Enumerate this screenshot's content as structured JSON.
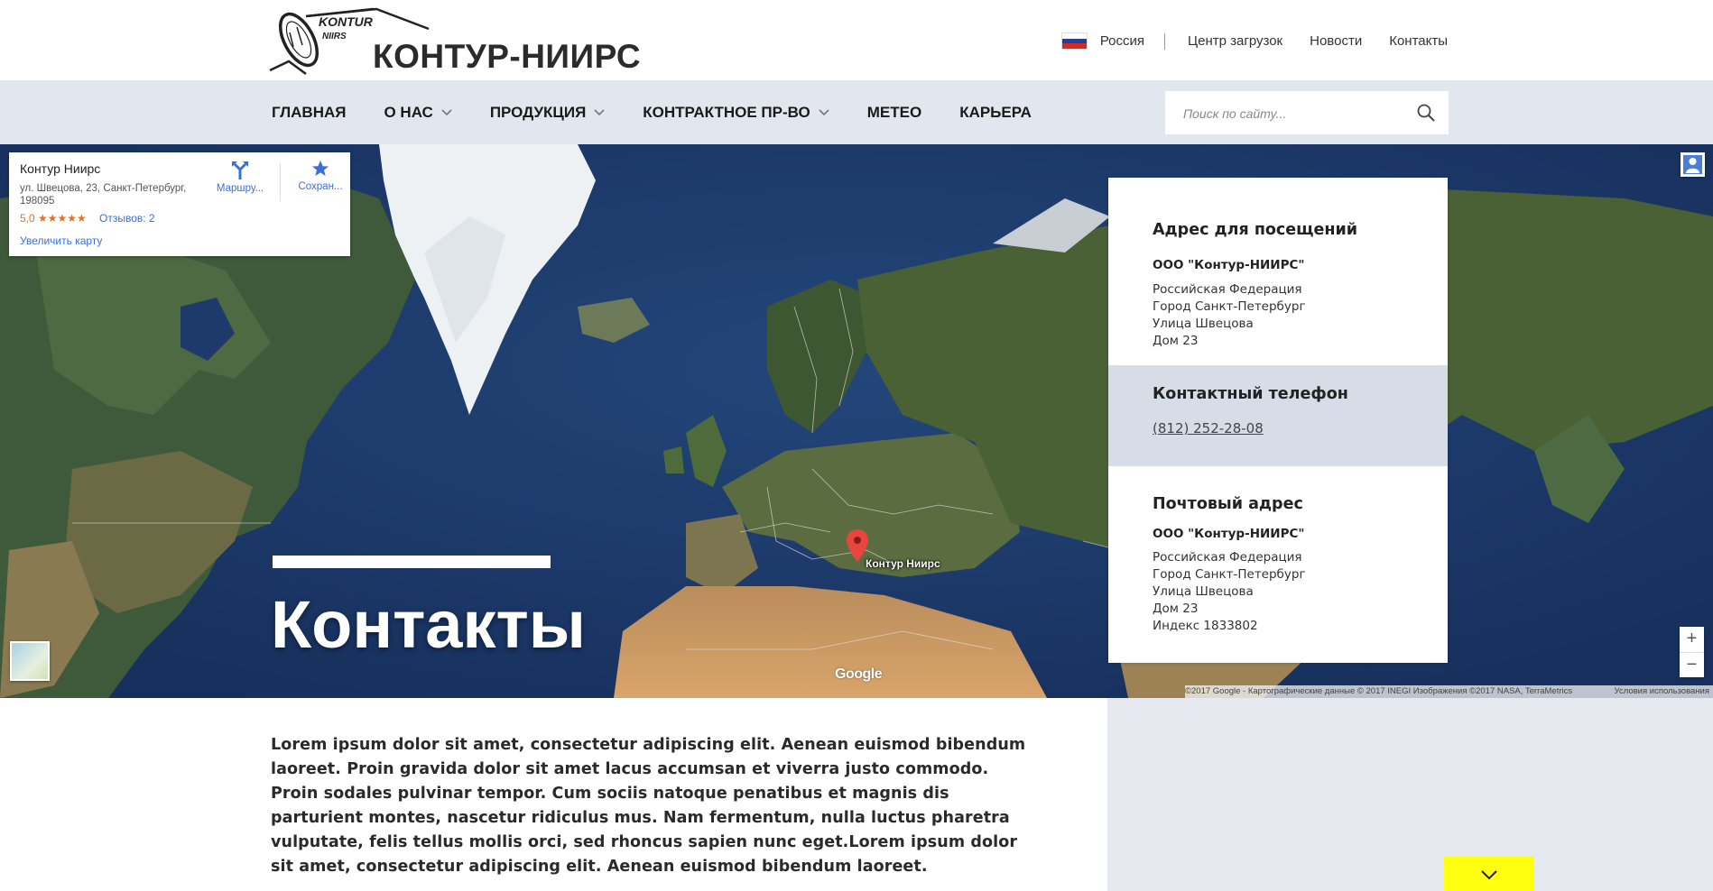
{
  "header": {
    "logo_small_top": "KONTUR",
    "logo_small_bottom": "NIIRS",
    "logo_text": "КОНТУР-НИИРС",
    "region": "Россия",
    "links": [
      "Центр загрузок",
      "Новости",
      "Контакты"
    ]
  },
  "nav": {
    "items": [
      {
        "label": "ГЛАВНАЯ"
      },
      {
        "label": "О НАС"
      },
      {
        "label": "ПРОДУКЦИЯ"
      },
      {
        "label": "КОНТРАКТНОЕ ПР-ВО"
      },
      {
        "label": "МЕТЕО"
      },
      {
        "label": "КАРЬЕРА"
      }
    ],
    "search_placeholder": "Поиск по сайту..."
  },
  "map": {
    "place_name": "Контур Ниирс",
    "place_address": "ул. Швецова, 23, Санкт-Петербург, 198095",
    "rating": "5,0 ★★★★★",
    "reviews": "Отзывов: 2",
    "route_label": "Маршру...",
    "save_label": "Сохран...",
    "enlarge": "Увеличить карту",
    "marker_label": "Контур Ниирс",
    "google": "Google",
    "attribution": "©2017 Google - Картографические данные © 2017 INEGI Изображения ©2017 NASA, TerraMetrics",
    "terms": "Условия использования",
    "zoom_in": "+",
    "zoom_out": "−"
  },
  "hero": {
    "title": "Контакты"
  },
  "contacts": {
    "visit": {
      "heading": "Адрес для посещений",
      "org": "ООО \"Контур-НИИРС\"",
      "lines": [
        "Российская Федерация",
        "Город Санкт-Петербург",
        "Улица Швецова",
        "Дом 23"
      ]
    },
    "phone": {
      "heading": "Контактный телефон",
      "number": "(812) 252-28-08"
    },
    "post": {
      "heading": "Почтовый адрес",
      "org": "ООО \"Контур-НИИРС\"",
      "lines": [
        "Российская Федерация",
        "Город Санкт-Петербург",
        "Улица Швецова",
        "Дом 23",
        "Индекс 1833802"
      ]
    }
  },
  "body": {
    "text": "Lorem ipsum dolor sit amet, consectetur adipiscing elit. Aenean euismod bibendum laoreet. Proin gravida dolor sit amet lacus accumsan et viverra justo commodo. Proin sodales pulvinar tempor. Cum sociis natoque penatibus et magnis dis parturient montes, nascetur ridiculus mus. Nam fermentum, nulla luctus pharetra vulputate, felis tellus mollis orci, sed rhoncus sapien nunc eget.Lorem ipsum dolor sit amet, consectetur adipiscing elit. Aenean euismod bibendum laoreet."
  },
  "colors": {
    "nav_bg": "#e2e6ee",
    "phone_section_bg": "#d6dde6",
    "scroll_button": "#ffff10",
    "link_blue": "#3a6fd8"
  }
}
